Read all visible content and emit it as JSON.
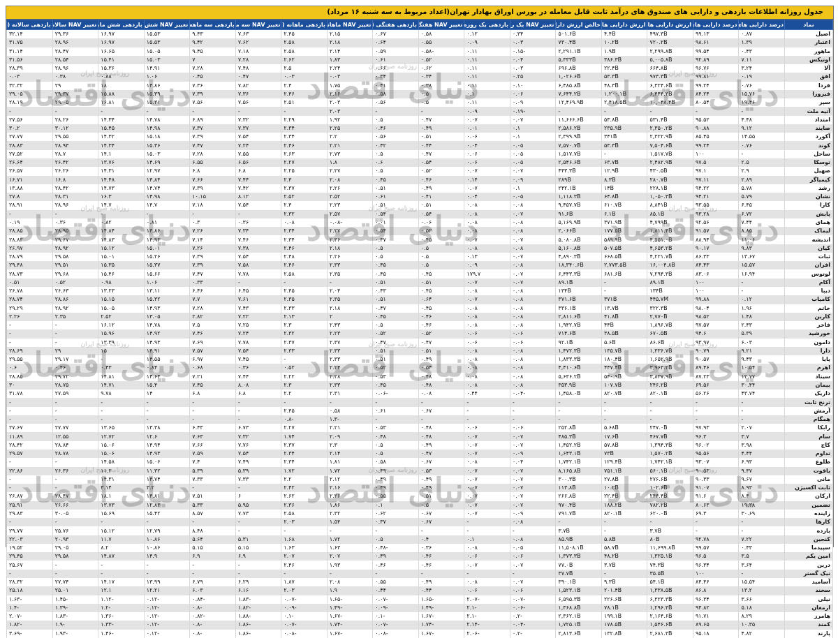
{
  "title": "جدول روزانه اطلاعات بازدهی و دارایی های صندوق های درآمد ثابت قابل معامله در بورس اوراق بهادار تهران(اعداد مربوط به سه شنبه ۱۶ مرداد)",
  "watermark": {
    "main": "دنیای اقتصاد",
    "sub": "روزنامه صبح ایران"
  },
  "headers": [
    "نماد",
    "درصد دارایی های پربریسک",
    "درصد دارایی های کم‌ریسک",
    "ارزش دارایی های کم‌ریسک",
    "ارزش دارایی های پرریسک",
    "خالص ارزش دارایی ها",
    "تغییر NAV یک روزه",
    "بازدهی یک روزه",
    "تغییر NAV هفتگی (۷روزه)",
    "بازدهی هفتگی (۷روزه)",
    "تغییر NAV ماهانه (۳۰روزه)",
    "بازدهی ماهانه (۳۰روزه)",
    "تغییر NAV سه ماهه (۹۰روزه)",
    "بازدهی سه ماهه (۹۰روزه)",
    "تغییر NAV شش ماهه (۱۸۰روزه)",
    "بازدهی شش ماهه (۱۸۰روزه)",
    "تغییر NAV سالانه (۳۶۵روزه)",
    "بازدهی سالانه (۳۶۵روزه)"
  ],
  "rows": [
    [
      "اصیل",
      "۰.۸۷",
      "۹۹.۱۳",
      "۴۹۷.۳B",
      "۴.۴B",
      "۵۰۱.۶B",
      "۰.۳۴",
      "۰.۱۲",
      "۰.۵۸",
      "۰.۶۷",
      "۲.۱۵",
      "۲.۴۵",
      "۷.۶۳",
      "۹.۴۳",
      "۱۵.۵۳",
      "۱۶.۹۷",
      "۲۹.۳۶",
      "۳۲.۱۴"
    ],
    [
      "اعتبار",
      "۱.۳۹",
      "۹۸.۶۱",
      "۷۲۰.۲B",
      "۱۰.۲B",
      "۷۳۰.۴B",
      "۰.۰۳",
      "۰.۰۹",
      "۰.۵۵",
      "۰.۶۴",
      "۲.۱۸",
      "۲.۵۸",
      "۷.۶۲",
      "۹.۴۲",
      "۱۵.۵۳",
      "۱۶.۹۷",
      "۲۸.۹۶",
      "۳۱.۷۵"
    ],
    [
      "ماهور",
      "۰.۴۳",
      "۹۹.۵۴",
      "۲,۲۹۹.۸B",
      "۱.۹B",
      "۲,۲۹۱.۱B",
      "-۰.۱۵",
      "۰.۱۱",
      "-۰.۵۸",
      "۰.۵۹",
      "۲.۱۴",
      "۲.۵۸",
      "۷.۱۸",
      "۹.۴۵",
      "۱۵.۰۵",
      "۱۶.۶۵",
      "۲۸.۴۷",
      "۳۱.۱۴"
    ],
    [
      "اوتیکس",
      "۷.۱۱",
      "۹۲.۸۹",
      "۵,۰۰۵.۸B",
      "۳۸۶.۳B",
      "۵,۳۳۳B",
      "۰.۰۴",
      "۰.۱۱",
      "۰.۵۲",
      "۰.۶۱",
      "۱.۸۳",
      "۲.۶۲",
      "۷.۲۸",
      "۷",
      "۱۵.۰۳",
      "۱۵.۴۱",
      "۲۸.۵۴",
      "۳۱.۵۶"
    ],
    [
      "آلا",
      "۳.۲۴",
      "۹۶.۷۶",
      "۶۶۴.۸B",
      "۲۲.۴B",
      "۶۹۶.۸B",
      "۰.۰۳",
      "۰.۱۱",
      "۰.۶۲",
      "۰.۶۶",
      "۲.۲۴",
      "۲.۵",
      "۷.۴۸",
      "۷.۲۸",
      "۱۴.۹۱",
      "۱۵.۳۶",
      "۲۸.۹۶",
      "۲۸.۳۹"
    ],
    [
      "افق",
      "۰.۱۹",
      "۹۹.۸۱",
      "۹۷۳.۳B",
      "۵۳.۳B",
      "۱,۰۲۶.۶B",
      "۰.۲۵",
      "۰.۱۱",
      "۰.۳۴",
      "۰.۳۴",
      "۰.۰۳",
      "۰.۰۳",
      "۰.۴۷",
      "۰.۴۵",
      "۱.۰۶",
      "۰.۸۸",
      "۰.۳۸",
      "۰.۰۳"
    ],
    [
      "فردا",
      "۰.۷۶",
      "۹۹.۲۴",
      "۶,۳۲۴.۶B",
      "۴۸.۳B",
      "۶,۴۸۵.۸B",
      "۰.۱۰",
      "۰.۱۱",
      "۰.۳۸",
      "۰.۴۱",
      "۱.۷۵",
      "۲.۴",
      "۷.۸۲",
      "۷.۳۶",
      "۱۴.۸۶",
      "۱۸",
      "۲۹",
      "۳۲.۳۲"
    ],
    [
      "فیروزا",
      "۱۵.۷۶",
      "۸۴.۲۴",
      "۶,۴۴۴.۳B",
      "۱,۲۰۰.۱B",
      "۷,۶۴۴.۲B",
      "۰.۰۶",
      "۰.۱",
      "۰.۵",
      "۰.۵۸",
      "۲.۱۶",
      "۲.۴۶",
      "۷.۳۶",
      "۷.۳۹",
      "۱۵.۳۹",
      "۱۵.۸۸",
      "۲۹.۳۷",
      "۲۹.۰۵"
    ],
    [
      "سپر",
      "۱۹.۴۶",
      "۸۰.۵۴",
      "۱۰,۰۴۸.۴B",
      "۲,۴۱۸.۵B",
      "۱۲,۴۶۹.۹B",
      "۰.۰۹",
      "۰.۱۱",
      "۰.۵",
      "۰.۵۶",
      "۲.۰۳",
      "۲.۵۱",
      "۷.۵۶",
      "۷.۵۶",
      "۱۵.۳۱",
      "۱۶.۸۱",
      "۲۹.۰۵",
      "۲۸.۱۹"
    ],
    [
      "آتیه ملت",
      "-",
      "-",
      "-",
      "-",
      "-",
      "-۰.۱۹",
      "۰.۰۹",
      "-",
      "-",
      "۲.۰۳",
      "-",
      "-",
      "-",
      "-",
      "-",
      "-",
      "-"
    ],
    [
      "امتداد",
      "۴.۴۸",
      "۹۵.۵۲",
      "۵۳۱.۴B",
      "۵۳.۸B",
      "۱۱,۶۶۶.۶B",
      "۰.۰۷",
      "۰.۰۷",
      "۰.۴۷",
      "۰.۵",
      "۱.۹۲",
      "۲.۲۹",
      "۷.۳۲",
      "۶.۸۹",
      "۱۴.۷۸",
      "۱۴.۳۴",
      "۲۸.۲۶",
      "۲۷.۵۶"
    ],
    [
      "صایند",
      "۹.۱۲",
      "۹۰.۸۸",
      "۲,۳۵۰.۲B",
      "۲۳۵.۹B",
      "۲,۵۸۶.۲B",
      "۰.۱",
      "۰.۰۱",
      "۰.۴۹",
      "۰.۴۶",
      "۲.۲۵",
      "۲.۳۴",
      "۷.۳۷",
      "۷.۳۷",
      "۱۴.۹۸",
      "۱۵.۴۵",
      "۳۰.۱۲",
      "۳۰.۲"
    ],
    [
      "آکورد",
      "۱۴.۵۵",
      "۸۵.۴۵",
      "۲,۳۲۲.۹B",
      "۳۴۱B",
      "۲,۳۹۹.۹B",
      "۰.۱",
      "۰.۰۶",
      "۰.۵۱",
      "۰.۵۶",
      "۲.۲",
      "۲.۳۴",
      "۷.۵۴",
      "۷.۳۹",
      "۱۵.۱۸",
      "۱۴.۳۲",
      "۲۹.۵۵",
      "۲۷.۷۷"
    ],
    [
      "کوند",
      "۰.۷۶",
      "۹۹.۲۴",
      "۷,۵۰۴.۶B",
      "۵۳.۳B",
      "۷,۵۷۰.۷B",
      "۰.۰۵",
      "۰.۰۴",
      "۰.۴۴",
      "۰.۴۲",
      "۲.۲۱",
      "۲.۴۶",
      "۷.۲۴",
      "۷.۴۷",
      "۱۵.۳۶",
      "۱۴.۳۴",
      "۲۸.۹۳",
      "۲۸.۸۳"
    ],
    [
      "ساحل",
      "-",
      "۱۰۰",
      "۱,۵۱۷.۷B",
      "-",
      "۱,۵۱۷.۷B",
      "۰.۰۵",
      "۰.۰۶",
      "۰.۴۷",
      "۰.۵",
      "۲.۷۳",
      "۲.۶۳",
      "۷.۵۵",
      "۷.۲۸",
      "۱۵.۰۳",
      "۱۴.۱",
      "۲۸.۷",
      "۲۷.۵۲"
    ],
    [
      "توسکا",
      "۲.۵",
      "۹۷.۵",
      "۲,۴۸۲.۹B",
      "۶۳.۷B",
      "۲,۵۴۶.۶B",
      "۰.۰۵",
      "۰.۰۶",
      "۰.۵۴",
      "۰.۶",
      "۱.۸",
      "۲.۲۷",
      "۶.۵۶",
      "۶.۵۵",
      "۱۴.۶۹",
      "۱۳.۷۶",
      "۲۶.۴۲",
      "۲۶.۶۴"
    ],
    [
      "صهیل",
      "۲.۹",
      "۹۷.۱",
      "۴۳۰.۵B",
      "۱۲.۹B",
      "۴۴۳.۳B",
      "۰.۰۷",
      "۰.۰۷",
      "۰.۵۲",
      "۰.۵",
      "۲.۲۷",
      "۲.۲۵",
      "۶.۸",
      "۶.۸",
      "۱۲.۹۷",
      "۱۴.۳۱",
      "۲۶.۲۶",
      "۲۶.۵۷"
    ],
    [
      "کیمیاگر",
      "۲.۸۹",
      "۹۷.۱۱",
      "۲۸۰.۷B",
      "۸.۳B",
      "۲۸۹B",
      "۰.۰۹",
      "۰.۱۴",
      "۰.۴۶",
      "۰.۴۵",
      "۲.۰۸",
      "۲.۴",
      "۷.۴۴",
      "۷.۶۶",
      "۱۴.۸۴",
      "۱۴.۴۸",
      "۱۶.۸",
      "۱۶.۷۱"
    ],
    [
      "رشد",
      "۵.۷۸",
      "۹۴.۲۲",
      "۲۲۸.۱B",
      "۱۴B",
      "۲۴۲.۱B",
      "۰.۱",
      "۰.۰۷",
      "۰.۴۹",
      "۰.۵۱",
      "۲.۲۶",
      "۲.۳۷",
      "۷.۴۲",
      "۷.۳۹",
      "۱۴.۷۴",
      "۱۴.۷۳",
      "۲۸.۴۲",
      "۱۳.۸۸"
    ],
    [
      "نشان",
      "۵.۷۹",
      "۹۴.۲۱",
      "۱,۰۵۰.۳B",
      "۶۴.۸B",
      "۱,۱۱۸.۳B",
      "۰.۰۵",
      "۰.۰۴",
      "۰.۴۱",
      "۰.۶۱",
      "۲.۵۲",
      "۲.۵۲",
      "۸.۱۲",
      "۱۰.۱۵",
      "۱۴.۹۸",
      "۱۶.۳",
      "۲۸.۳۱",
      "۲۷.۸"
    ],
    [
      "کارا",
      "۶.۴۵",
      "۹۳.۵۵",
      "۸,۸۴۱B",
      "۶۱۰.۷B",
      "۹,۴۵۷.۷B",
      "۰.۰۸",
      "۰.۰۸",
      "۰.۵۱",
      "۰.۵۱",
      "۲.۲۳",
      "۲.۴",
      "۷.۵۴",
      "۷.۱۸",
      "۱۴.۷",
      "۱۴.۷",
      "۲۸.۹۶",
      "۲۸.۹۱"
    ],
    [
      "پایش",
      "۶.۷۲",
      "۹۳.۲۸",
      "۸۵.۱B",
      "۶.۱B",
      "۹۱.۶B",
      "۰.۰۷",
      "۰.۰۸",
      "۰.۵۴",
      "۰.۵۴",
      "۲.۵۷",
      "۲.۳۲",
      "-",
      "-",
      "-",
      "-",
      "-",
      "-"
    ],
    [
      "همای",
      "۷.۴۴",
      "۹۲.۵۶",
      "۴,۷۹۹B",
      "۳۷۱.۹B",
      "۵,۱۶۹.۹B",
      "۰.۰۸",
      "۰.۰۸",
      "۰.۰۶",
      "۰.۰۱",
      "-۰.۰۸",
      "۰.۰۸",
      "۰.۳۶",
      "۰.۳",
      "۰.۸۱",
      "۰.۸۲",
      "۰.۳۶",
      "۰.۱۹"
    ],
    [
      "لیماک",
      "۸.۸۵",
      "۹۱.۵۷",
      "۱,۸۱۱.۴B",
      "۱۷۷.۵B",
      "۲,۰۶۶B",
      "۰.۰۸",
      "۰.۰۸",
      "۰.۵۲",
      "۰.۵۴",
      "۲.۲۷",
      "۲.۳۴",
      "۷.۳۴",
      "۷.۲۶",
      "۱۴.۸۶",
      "۱۴.۸۴",
      "۲۸.۹۵",
      "۲۸.۸۵"
    ],
    [
      "اندیشه",
      "۱۱.۰۶",
      "۸۸.۹۴",
      "۴,۵۵۱.۰B",
      "۵۸۹.۹B",
      "۵,۰۸۰.۸B",
      "۰.۰۷",
      "۰.۰۷",
      "۰.۴۵",
      "۰.۴۷",
      "۲.۳۶",
      "۲.۳۴",
      "۷.۴۶",
      "۷.۱۴",
      "۱۴.۹۳",
      "۱۴.۸۳",
      "۲۹.۶۷",
      "۲۸.۸۳"
    ],
    [
      "کیان",
      "۹.۸۳",
      "۹۰.۱۷",
      "۴,۶۵۳.۲B",
      "۵۰۷.۵B",
      "۵,۱۶۰.۸B",
      "۰.۰۸",
      "۰.۰۸",
      "۰.۵",
      "۰.۵",
      "۲.۱۸",
      "۲.۴۶",
      "۷.۳۸",
      "۷.۲۶",
      "۱۵.۰۱",
      "۱۵.۱۲",
      "۲۸.۹۲",
      "۲۶.۹۷"
    ],
    [
      "ثبات",
      "۱۳.۶۷",
      "۸۶.۳۳",
      "۴,۲۲۱.۷B",
      "۶۶۸.۵B",
      "۴,۸۹۰.۳B",
      "۰.۰۷",
      "۰.۱۳",
      "۰.۵",
      "۰.۵",
      "۲.۲۶",
      "۲.۴۸",
      "۷.۵۴",
      "۷.۳۹",
      "۱۵.۲۶",
      "۱۵.۰۱",
      "۲۹.۵۸",
      "۲۸.۷۹"
    ],
    [
      "افران",
      "۱۵.۵۷",
      "۸۴.۴۳",
      "۱۶,۰۰۴.۸B",
      "۲,۷۷۳.۵B",
      "۱۸,۳۴۰.۶B",
      "۰.۰۸",
      "۰.۰۹",
      "۰.۵",
      "۰.۴۵",
      "۲.۳۳",
      "۲.۴۶",
      "۷.۵۸",
      "۷.۳۹",
      "۱۵.۳۷",
      "۱۵.۳۵",
      "۲۹.۵۱",
      "۲۹.۴۸"
    ],
    [
      "لوتوس",
      "۱۶.۹۴",
      "۸۳.۰۶",
      "۷,۲۹۴.۳B",
      "۶۸۱.۶B",
      "۶,۴۴۳.۳B",
      "۰.۰۷",
      "۱۷۹.۷",
      "۰.۴۵",
      "۰.۴۵",
      "۲.۳۵",
      "۲.۵۸",
      "۷.۷۸",
      "۷.۴۷",
      "۱۵.۶۶",
      "۱۵.۴۶",
      "۲۹.۶۸",
      "۲۸.۷۳"
    ],
    [
      "آکام",
      "-",
      "۱۰۰",
      "۸۹.۱B",
      "-",
      "۸۹.۱B",
      "۰.۰۷",
      "۰.۰۷",
      "۰.۵۱",
      "۰.۵۱",
      "-",
      "-",
      "-",
      "۰.۳۳",
      "۱.۰۶",
      "۰.۹۸",
      "۰.۵۲",
      "۰.۵۱"
    ],
    [
      "دیبا",
      "-",
      "۱۰۰",
      "۱۳۴B",
      "-",
      "۱۳۴B",
      "۰.۰۸",
      "۰.۰۸",
      "۰.۴۵",
      "۰.۴۳",
      "۲.۰۴",
      "۲.۴۵",
      "۶.۴۵",
      "۶.۴۶",
      "۱۳.۱۱",
      "۱۳.۲۳",
      "۲۶.۶۳",
      "۲۶.۷۸"
    ],
    [
      "کامیاب",
      "۰.۱۲",
      "۹۹.۸۸",
      "۴۴۵.۷M",
      "۳۷۱B",
      "۳۷۱.۶B",
      "۰.۰۸",
      "۰.۰۷",
      "۰.۶۴",
      "۰.۵۱",
      "۲.۳۵",
      "۲.۳۵",
      "۷.۶۱",
      "۷.۷",
      "۱۵.۳۲",
      "۱۵.۱۵",
      "۲۸.۸۶",
      "۲۸.۷۴"
    ],
    [
      "خاتم",
      "۱.۹۶",
      "۹۸.۰۴",
      "۳۲۲.۳B",
      "۱۳.۷B",
      "۳۳۶.۱B",
      "۰.۰۸",
      "۰.۰۸",
      "۰.۴۵",
      "۰.۴۷",
      "۲.۱۸",
      "۲.۳۳",
      "۷.۴۳",
      "۷.۲۸",
      "۱۴.۹۳",
      "۱۵.۰۵",
      "۲۸.۹۲",
      "۲۹.۲۹"
    ],
    [
      "کارین",
      "۱.۴۸",
      "۹۸.۵۲",
      "۲,۷۷۰B",
      "۴۱.۸B",
      "۲,۸۱۱.۶B",
      "۰.۰۸",
      "۰.۰۸",
      "۰.۴۶",
      "۰.۴۵",
      "۲",
      "۲.۱۳",
      "۷.۲۲",
      "۲.۸۲",
      "۱۳.۰۵",
      "۲.۵۲",
      "۲.۳۵",
      "۲.۲۶"
    ],
    [
      "فاخر",
      "۲.۴۳",
      "۹۷.۵۷",
      "۱,۸۹۶.۷B",
      "۴۴B",
      "۱,۹۴۲.۷B",
      "۰.۰۸",
      "۰.۰۸",
      "۰.۴۶",
      "۰.۵",
      "۲.۴۳",
      "۲.۳",
      "۷.۲۵",
      "۷.۵",
      "۱۴.۷۸",
      "۱۶.۱۲",
      "-",
      "-"
    ],
    [
      "خورشید",
      "۵.۳۹",
      "۹۴.۶",
      "۶۷۰.۵B",
      "۳۸.۵B",
      "۷۱۴.۶B",
      "۰.۰۶",
      "۰.۰۶",
      "۰.۵۲",
      "۰.۵۲",
      "۲.۲۳",
      "۲.۳۲",
      "۷.۲۴",
      "۷.۴۶",
      "۱۴.۹۲",
      "۱۵.۹۶",
      "-",
      "-"
    ],
    [
      "دامون",
      "۶.۰۳",
      "۹۳.۹۷",
      "۸۶.۶B",
      "۵.۶B",
      "۹۲.۱B",
      "۰.۰۶",
      "۰.۰۶",
      "۰.۴۷",
      "۰.۴۷",
      "۲.۳۷",
      "۲.۳۷",
      "۷.۷۸",
      "۷.۶۹",
      "۱۴.۹۳",
      "۱۳.۳۹",
      "-",
      "-"
    ],
    [
      "دارا",
      "۹.۲۱",
      "۹۰.۷۹",
      "۱,۳۳۶.۷B",
      "۱۳۵.۷B",
      "۱,۴۷۲.۳B",
      "۰.۰۸",
      "۰.۰۸",
      "۰.۵۱",
      "۰.۵۱",
      "۲.۳۳",
      "۲.۳۳",
      "۷.۵۴",
      "۷.۵۷",
      "۱۴.۹۱",
      "۱۵",
      "۲۹",
      "۲۸.۶۹"
    ],
    [
      "پایا",
      "۹.۴۳",
      "۹۰.۵۷",
      "۱,۶۵۲.۹B",
      "۱۸۰.۴B",
      "۱,۸۳۳.۳B",
      "۰.۰۸",
      "۰.۰۸",
      "۰.۴۹",
      "۰.۵۱",
      "۲.۳۳",
      "-",
      "۷.۴۵",
      "۶.۹۷",
      "۱۴.۵۵",
      "-",
      "۲۹.۱۷",
      "۲۹.۵۵"
    ],
    [
      "اهرم",
      "۱۰.۵۴",
      "۸۹.۴۶",
      "۳,۹۶۳.۲B",
      "۴۴۷.۴B",
      "۴,۴۱۰.۶B",
      "۰.۰۸",
      "۰.۰۸",
      "۰.۵۴",
      "۰.۵۲",
      "۲.۲۴",
      "۰.۵۲",
      "۰.۳۶",
      "۰.۶۸",
      "۰.۸۴",
      "۰.۴۳",
      "۰.۴۶",
      "۰.۶"
    ],
    [
      "سیناد",
      "۱۲.۷۷",
      "۸۷.۲۳",
      "۳,۸۳۷.۹B",
      "۵۴۰.۹B",
      "۵,۶۳۶.۲B",
      "۰.۰۸",
      "۰.۰۸",
      "۰.۴۸",
      "۰.۵۳",
      "۲.۲۸",
      "۲.۲۲",
      "۷.۴۴",
      "۷.۲۱",
      "۱۴.۶۴",
      "۱۴.۸۱",
      "۲۹.۷۲",
      "۲۸.۸۵"
    ],
    [
      "بیمان",
      "۳۰.۴۴",
      "۶۹.۵۶",
      "۲۴۶.۲B",
      "۱۰۷.۷B",
      "۳۵۳.۹B",
      "۰.۰۸",
      "۰.۰۸",
      "۰.۴۸",
      "۰.۴۵",
      "۲.۳۳",
      "۲.۳",
      "۸.۰۸",
      "۷.۴۵",
      "۱۵.۴",
      "۱۴.۷۱",
      "۲۸.۷۵",
      "۳۰"
    ],
    [
      "داریک",
      "۴۳.۷۴",
      "۵۶.۲۶",
      "۸۲۰.۱B",
      "۸۲۰.۷B",
      "۱,۴۵۸.۰B",
      "-۰.۰۴",
      "۰.۴۴",
      "۰.۰۸",
      "-۰.۰۶",
      "۲.۳۱",
      "۲.۲",
      "۶.۸",
      "۶.۸",
      "۱۴",
      "۹.۷۸",
      "۲۷.۵۹",
      "۳۱.۷۸"
    ],
    [
      "ترنج ثابت",
      "-",
      "-",
      "-",
      "-",
      "-",
      "-",
      "-",
      "-",
      "-",
      "-",
      "-",
      "-",
      "-",
      "-",
      "-",
      "-",
      "-"
    ],
    [
      "آرمش",
      "-",
      "-",
      "-",
      "-",
      "-",
      "-",
      "-",
      "۰.۶۷",
      "۰.۶۱",
      "۰.۵۸",
      "۲.۴۵",
      "-",
      "-",
      "-",
      "-",
      "-",
      "-"
    ],
    [
      "همگام",
      "-",
      "-",
      "-",
      "-",
      "-",
      "-",
      "-",
      "-",
      "-",
      "-۱.۳",
      "-۰.۸",
      "-",
      "-",
      "-",
      "-",
      "-",
      "-"
    ],
    [
      "رابکا",
      "۲.۰۷",
      "۹۷.۹۳",
      "۲۴۷.۰B",
      "۵.۶۸B",
      "۲۵۲.۸B",
      "۰.۰۶",
      "۰.۰۶",
      "۰.۴۸",
      "۰.۵۳",
      "۲.۲۱",
      "۲.۲۷",
      "۶.۷۳",
      "۶.۴۳",
      "۱۳.۳۸",
      "۱۳.۶۵",
      "۲۷.۷۷",
      "۲۷.۶۷"
    ],
    [
      "سام",
      "۳.۷",
      "۹۶.۳",
      "۴۶۷.۷B",
      "۱۷.۶B",
      "۴۸۵.۳B",
      "۰.۰۷",
      "۰.۰۷",
      "۰.۴۸",
      "۰.۴۸",
      "۲.۰۹",
      "۱.۷۴",
      "۷.۳۲",
      "۷.۶۳",
      "۱۲.۶",
      "۱۲.۷۲",
      "۱۲.۵۵",
      "۱۱.۸۹"
    ],
    [
      "کاج",
      "۳.۹۸",
      "۹۶.۰۲",
      "۱,۳۹۴.۳B",
      "۵۷.۸B",
      "۱,۴۵۲.۲B",
      "۰.۰۷",
      "۰.۰۷",
      "۰.۴۹",
      "۰.۵",
      "۲.۳",
      "۲.۳۷",
      "۷.۷۶",
      "۷.۶۶",
      "۱۴.۹۴",
      "۱۵.۰۶",
      "۲۸.۸۴",
      "۲۸.۴۲"
    ],
    [
      "تداوم",
      "۴.۴۴",
      "۹۵.۵۶",
      "۱,۵۷۰.۲B",
      "۷۳B",
      "۱,۶۴۳.۱B",
      "۰.۰۹",
      "۰.۰۷",
      "۰.۴۷",
      "۰.۵",
      "۲.۱۴",
      "۲.۳۴",
      "۷.۵۴",
      "۷.۵۹",
      "۱۴.۹۳",
      "۱۵.۰۶",
      "۲۸.۷۸",
      "۲۹.۵۷"
    ],
    [
      "طلوع",
      "۶.۹۳",
      "۹۳.۰۷",
      "۱,۷۴۲.۱B",
      "۱۲۹.۴B",
      "۱,۷۴۲.۱B",
      "۰.۰۴",
      "۰.۰۸",
      "۰.۶۷",
      "۰.۵۸",
      "۱.۸۱",
      "۲.۳۴",
      "۷.۴۹",
      "۷.۴",
      "۱۵.۰۶",
      "۱۴.۵۸",
      "-",
      "-"
    ],
    [
      "یاقوت",
      "۹.۴۷",
      "۹۰.۵۳",
      "۵۶۰.۱B",
      "۷۵۱.۱B",
      "۸,۱۶۵.۸B",
      "۰.۰۷",
      "۰.۰۷",
      "۰.۵۳",
      "۰.۴۹",
      "۱.۷۲",
      "۱.۷۲",
      "۵.۳۹",
      "۵.۳۹",
      "۱۱.۳۲",
      "۱۱.۲",
      "۲۶.۳۶",
      "۲۲.۸۶"
    ],
    [
      "مانی",
      "۹.۶۷",
      "۹۰.۳۳",
      "۲۷۶.۶B",
      "۲۷.۸B",
      "۳۰۰.۳B",
      "۰.۰۷",
      "۰.۰۷",
      "۰.۴۹",
      "۰.۴۹",
      "۲.۱۲",
      "۲.۲",
      "۷.۳۳",
      "۷.۳۳",
      "۱۴.۷۴",
      "۱۴.۳۱",
      "-",
      "-"
    ],
    [
      "ثابت اکسیژن",
      "۸.۹۳",
      "۹۱.۰۷",
      "۱۰۲.۶B",
      "۱۰.۲B",
      "۱۱۳.۸B",
      "۰.۰۷",
      "۰.۰۷",
      "۰.۴۹",
      "۰.۴۹",
      "۲.۱۶",
      "۲.۴۲",
      "-",
      "-",
      "۳.۲",
      "۳.۱۴",
      "-",
      "-"
    ],
    [
      "ارکان",
      "۸.۴",
      "۹۱.۶",
      "۲۴۴.۴B",
      "۲۲.۴B",
      "۲۶۶.۸B",
      "۰.۰۷",
      "۰.۰۷",
      "۰.۵۱",
      "۰.۵۵",
      "۲.۳۶",
      "۲.۶۲",
      "۶",
      "۷.۵۱",
      "۱۴.۸۱",
      "۱۸.۱",
      "۲۸.۴۷",
      "۲۶.۸۷"
    ],
    [
      "تضمین",
      "۱۹.۳۸",
      "۸۰.۶۳",
      "۷۸۲.۲B",
      "۱۸۸.۲B",
      "۹۷۰.۴B",
      "۰.۰۷",
      "۰.۰۷",
      "۰.۵",
      "۰.۱",
      "۱.۸۶",
      "۲.۳۶",
      "۵.۹۵",
      "۵.۳۳",
      "۱۲.۸۳",
      "۱۳.۷۳",
      "۲۶.۶۶",
      "۲۵.۹۱"
    ],
    [
      "زاینده",
      "۳۰.۶۹",
      "۶۹.۳",
      "۶۲۰.۰B",
      "۸۲۰.۱B",
      "۷۹۱.۷B",
      "۰.۰۹",
      "۰.۰۷",
      "۰.۶۷",
      "۰.۶۲",
      "۲.۳۲",
      "۲.۵۸",
      "۷.۷۳",
      "۸.۵۷",
      "۱۵.۴۲",
      "۱۵.۶۹",
      "۳۰.۰۵",
      "۲۹.۸۳"
    ],
    [
      "کارها",
      "-",
      "-",
      "-",
      "-",
      "-",
      "۰.۰۸",
      "-",
      "۰.۶۷",
      "۰.۳۷",
      "۱.۵۴",
      "۲.۰۳",
      "-",
      "-",
      "-",
      "-",
      "-",
      "-"
    ],
    [
      "بازده",
      "-",
      "-",
      "۳.۷B",
      "-",
      "۳.۷B",
      "-",
      "-",
      "-",
      "-",
      "-",
      "-",
      "-",
      "۸.۴۸",
      "۱۲.۷۹",
      "۱۵.۱۲",
      "۲۵.۷۶",
      "۲۹.۷۷"
    ],
    [
      "کنجین",
      "۷.۲۲",
      "۹۲.۷۸",
      "۸۰B",
      "۵.۸B",
      "۸۵.۹B",
      "۰.۰۸",
      "۰.۱",
      "۰.۴",
      "۰.۵",
      "۱.۷۲",
      "۱.۶۸",
      "۵.۳۱",
      "۵.۶۴",
      "۱۰.۸۶",
      "۱۱.۷",
      "۲۰.۹۳",
      "۲۲.۰۳"
    ],
    [
      "سپیدما",
      "۰.۴۳",
      "۹۹.۵۷",
      "۱۱,۶۹۹.۸B",
      "۵۸.۷B",
      "۱۱,۵۰۸.۱B",
      "۰.۰۵",
      "۰.۰۸",
      "۰.۳۶",
      "-۰.۴۸",
      "۱.۶۳",
      "۱.۶۳",
      "۵.۱۵",
      "۵.۱۵",
      "۱۰.۸۶",
      "۸.۲",
      "۲۹.۰۵",
      "۱۹.۵۲"
    ],
    [
      "امین یکم",
      "۳.۵",
      "۹۶.۵",
      "۱,۳۲۵.۱B",
      "۴۸.۲B",
      "۱,۳۷۳.۳B",
      "۰.۰۶",
      "۰.۰۶",
      "۰.۴۶",
      "۰.۴۹",
      "۲.۰۷",
      "۲.۰۷",
      "۶.۹",
      "۶.۹",
      "۱۴.۹",
      "۱۴.۸۷",
      "۲۹.۵۸",
      "۲۹.۴۵"
    ],
    [
      "درین",
      "۳.۶۴",
      "۹۶.۳۴",
      "۷۴.۳B",
      "۳.۷B",
      "۷۷.۰B",
      "۰.۰۷",
      "۰.۰۷",
      "۰.۴۶",
      "۰.۴۶",
      "۱.۹۳",
      "۲.۴۶",
      "-",
      "-",
      "-",
      "-",
      "-",
      "۲۵.۶۷"
    ],
    [
      "نیک گستر",
      "-",
      "۱۰۰",
      "۳۵.۵B",
      "-",
      "۳۷.۷B",
      "-",
      "-",
      "-",
      "-",
      "-",
      "-",
      "-",
      "-",
      "-",
      "-",
      "-",
      "-"
    ],
    [
      "آسامید",
      "۱۵.۵۴",
      "۸۴.۴۶",
      "۵۴.۱B",
      "۹.۳B",
      "۳۹۰.۱B",
      "۰.۰۷",
      "۰.۰۸",
      "۰.۴۹",
      "۰.۵۵",
      "۲.۰۸",
      "۱.۸۷",
      "۶.۲۹",
      "۶.۷۹",
      "۱۳.۹۹",
      "۱۴.۱۷",
      "۲۷.۷۴",
      "۲۸.۳۲"
    ],
    [
      "سخند",
      "۱۳.۲",
      "۸۶.۸",
      "۱,۳۳۸.۵B",
      "۲۰۱.۴B",
      "۱,۵۲۳.۱B",
      "۰.۰۶",
      "۰.۰۶",
      "۰.۴۴",
      "۰.۴۴",
      "۱.۹",
      "۲.۰۳",
      "۶.۱۶",
      "۶.۰۳",
      "۱۲.۲۱",
      "۱۲.۱",
      "۲۵.۰۱",
      "۲۵.۱۸"
    ],
    [
      "نیلی",
      "۳.۶۶",
      "۹۶.۳۴",
      "۶,۳۲۳.۳B",
      "۲۲۶.۶B",
      "۶,۵۹۵.۳B",
      "-۰.۰۷",
      "-۲.۰۷",
      "-۱.۶۵",
      "-۰.۰۷",
      "-۱.۶۵",
      "-۰.۰۷",
      "-۱.۸۳",
      "-۰.۸۴",
      "-۰.۱۲",
      "-۱.۱۲",
      "-۱.۴۵",
      "-۱.۶۳"
    ],
    [
      "ارمغان",
      "۵.۱۸",
      "۹۴.۸۲",
      "۱,۲۹۶.۳B",
      "۷۸.۱B",
      "۱,۳۶۸.۸B",
      "-۰.۰۶",
      "-۲.۱",
      "-۱.۴۹",
      "-۰.۰۹",
      "-۱.۴۹",
      "-۰.۰۹",
      "-۱.۸۲",
      "-۰.۸",
      "-۰.۱۲",
      "-۱.۲",
      "-۱.۳۹",
      "-۱.۴"
    ],
    [
      "هامرز",
      "۸.۲۹",
      "۹۱.۷۱",
      "۲,۱۶۴.۶B",
      "۱۹۹.۱B",
      "۲,۳۶۲.۱B",
      "-۰.۲",
      "-۲.۱",
      "-۱.۶۷",
      "-۰.۱",
      "-۱.۶۷",
      "-۰.۱",
      "-۱.۸۸",
      "-۰.۸۲",
      "-۰.۱۲",
      "-۱.۳۶",
      "-۱.۸۳",
      "-۲.۰۷"
    ],
    [
      "کمند",
      "۱۰.۳۵",
      "۸۹.۶۵",
      "۱,۵۴۶.۶B",
      "۱۷۸.۵B",
      "۱,۷۲۵.۱B",
      "-۰.۰۴",
      "-۲.۱۴",
      "-۱.۷۴",
      "-۰.۰۷",
      "-۱.۷۴",
      "-۰.۰۷",
      "-۱.۸۶",
      "-۰.۸",
      "-۰.۱۲",
      "-۱.۳۳",
      "-۱.۹",
      "-۱.۸۲"
    ],
    [
      "پارند",
      "۴.۸۲",
      "۹۵.۱۸",
      "۲,۶۸۱.۳B",
      "۱۳۲.۸B",
      "۲,۸۱۳.۶B",
      "-۰.۲",
      "-۲.۰۶",
      "-۱.۶۷",
      "-۰.۰۸",
      "-۱.۶۷",
      "-۰.۰۸",
      "-۱.۸۶",
      "-۰.۸",
      "-۰.۱۲",
      "-۱.۴۶",
      "-۱.۹۳",
      "-۳.۶۹"
    ]
  ]
}
